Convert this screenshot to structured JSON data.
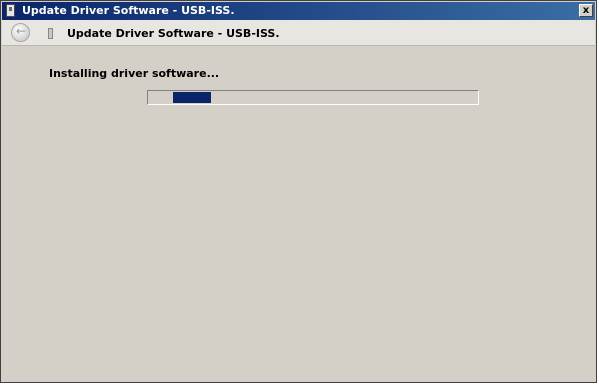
{
  "window": {
    "title": "Update Driver Software - USB-ISS.",
    "close_label": "x"
  },
  "nav": {
    "title": "Update Driver Software - USB-ISS.",
    "back_label": "←"
  },
  "main": {
    "heading": "Installing driver software...",
    "progress_indeterminate": true
  },
  "colors": {
    "titlebar": "#0a246a",
    "window_bg": "#d4d0c8",
    "progress_fill": "#0a246a"
  }
}
